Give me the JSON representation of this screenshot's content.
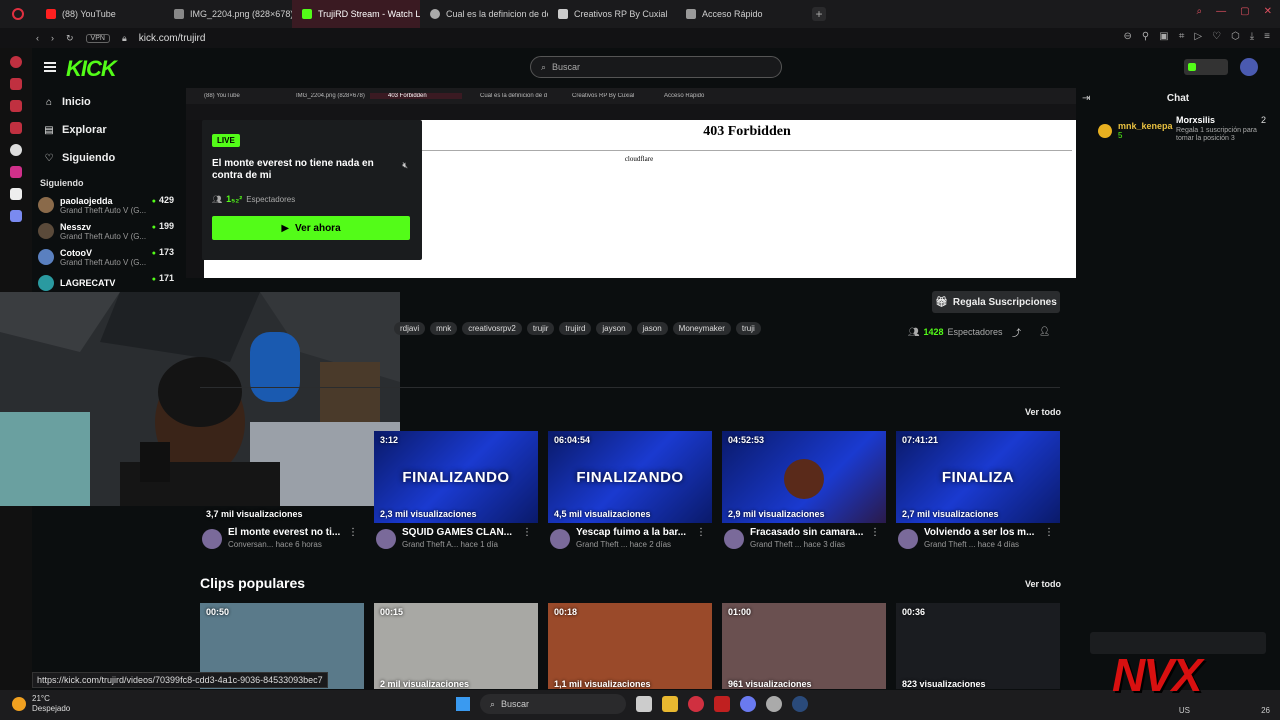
{
  "browser": {
    "tabs": [
      {
        "label": "(88) YouTube",
        "color": "#ff2020"
      },
      {
        "label": "IMG_2204.png (828×678)",
        "color": "#888888"
      },
      {
        "label": "TrujiRD Stream - Watch Li",
        "color": "#53fc18"
      },
      {
        "label": "Cual es la definicion de de",
        "color": "#aaaaaa"
      },
      {
        "label": "Creativos RP By Cuxial",
        "color": "#cccccc"
      },
      {
        "label": "Acceso Rápido",
        "color": "#999999"
      }
    ],
    "tab_plus": "+",
    "vpn": "VPN",
    "url": "kick.com/trujird"
  },
  "header": {
    "logo": "KICK",
    "search_placeholder": "Buscar"
  },
  "nav": {
    "items": [
      {
        "label": "Inicio",
        "icon": "⌂"
      },
      {
        "label": "Explorar",
        "icon": "▤"
      },
      {
        "label": "Siguiendo",
        "icon": "♡"
      }
    ],
    "following_title": "Siguiendo",
    "following": [
      {
        "name": "paolaojedda",
        "game": "Grand Theft Auto V (G...",
        "count": "429"
      },
      {
        "name": "Nesszv",
        "game": "Grand Theft Auto V (G...",
        "count": "199"
      },
      {
        "name": "CotooV",
        "game": "Grand Theft Auto V (G...",
        "count": "173"
      },
      {
        "name": "LAGRECATV",
        "game": "",
        "count": "171"
      }
    ]
  },
  "embed": {
    "tabs": [
      "(88) YouTube",
      "IMG_2204.png (828×678)",
      "403 Forbidden",
      "Cual es la definicion de d",
      "Creativos RP By Cuxial",
      "Acceso Rápido"
    ],
    "error_title": "403 Forbidden",
    "error_sub": "cloudflare"
  },
  "livecard": {
    "badge": "LIVE",
    "title": "El monte everest no tiene nada en contra de mi",
    "viewers": "1₅₂²",
    "viewers_label": "Espectadores",
    "watch_label": "Ver ahora"
  },
  "channel": {
    "gift_label": "Regala Suscripciones",
    "tags": [
      "rdjavi",
      "mnk",
      "creativosrpv2",
      "trujir",
      "trujird",
      "jayson",
      "jason",
      "Moneymaker",
      "truji"
    ],
    "viewers_count": "1428",
    "viewers_label": "Espectadores",
    "see_all": "Ver todo"
  },
  "videos": [
    {
      "duration": "",
      "views": "3,7 mil visualizaciones",
      "title": "El monte everest no ti...",
      "sub": "Conversan...  hace 6 horas",
      "fin": ""
    },
    {
      "duration": "3:12",
      "views": "2,3 mil visualizaciones",
      "title": "SQUID GAMES CLAN...",
      "sub": "Grand Theft A...  hace 1 día",
      "fin": "FINALIZANDO"
    },
    {
      "duration": "06:04:54",
      "views": "4,5 mil visualizaciones",
      "title": "Yescap fuimo a la bar...",
      "sub": "Grand Theft ...  hace 2 días",
      "fin": "FINALIZANDO"
    },
    {
      "duration": "04:52:53",
      "views": "2,9 mil visualizaciones",
      "title": "Fracasado sin camara...",
      "sub": "Grand Theft ...  hace 3 días",
      "fin": ""
    },
    {
      "duration": "07:41:21",
      "views": "2,7 mil visualizaciones",
      "title": "Volviendo a ser los m...",
      "sub": "Grand Theft ...  hace 4 días",
      "fin": "FINALIZA"
    }
  ],
  "clips": {
    "title": "Clips populares",
    "see_all": "Ver todo",
    "items": [
      {
        "duration": "00:50",
        "views": ""
      },
      {
        "duration": "00:15",
        "views": "2 mil visualizaciones"
      },
      {
        "duration": "00:18",
        "views": "1,1 mil visualizaciones"
      },
      {
        "duration": "01:00",
        "views": "961 visualizaciones"
      },
      {
        "duration": "00:36",
        "views": "823 visualizaciones"
      }
    ]
  },
  "chat": {
    "title": "Chat",
    "top_user": "mnk_kenepa",
    "top_user_count": "5",
    "gifter_name": "Morxsilis",
    "gifter_count": "2",
    "gifter_desc": "Regala 1 suscripción para tomar la posición 3"
  },
  "status_url": "https://kick.com/trujird/videos/70399fc8-cdd3-4a1c-9036-84533093bec7",
  "taskbar": {
    "temp": "21°C",
    "weather": "Despejado",
    "search": "Buscar",
    "locale": "US",
    "time_partial": "26"
  },
  "overlay_logo": "NVX",
  "colors": {
    "accent": "#53fc18",
    "brand_red": "#d81010"
  }
}
